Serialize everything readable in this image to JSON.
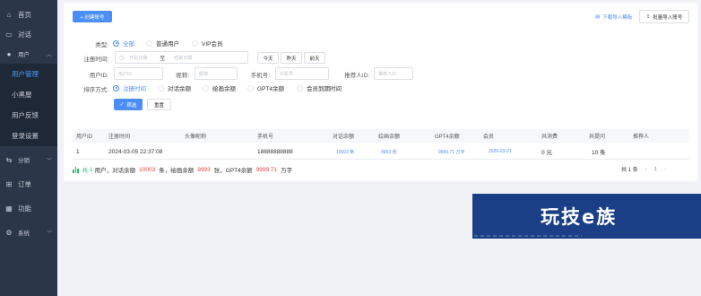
{
  "sidebar": {
    "items": [
      {
        "icon": "home-icon",
        "label": "首页"
      },
      {
        "icon": "chat-icon",
        "label": "对话"
      },
      {
        "icon": "user-icon",
        "label": "用户"
      }
    ],
    "sub_items": [
      {
        "label": "用户管理"
      },
      {
        "label": "小黑屋"
      },
      {
        "label": "用户反馈"
      },
      {
        "label": "登录设置"
      }
    ],
    "more_items": [
      {
        "icon": "share-icon",
        "label": "分销"
      },
      {
        "icon": "cart-icon",
        "label": "订单"
      },
      {
        "icon": "grid-icon",
        "label": "功能"
      },
      {
        "icon": "gear-icon",
        "label": "系统"
      }
    ]
  },
  "toolbar": {
    "create_label": "+ 创建账号",
    "download_label": "下载导入模板",
    "import_label": "批量导入账号"
  },
  "filters": {
    "type_label": "类型:",
    "type_options": [
      "全部",
      "普通用户",
      "VIP会员"
    ],
    "reg_time_label": "注册时间:",
    "start_placeholder": "开始日期",
    "to_label": "至",
    "end_placeholder": "结束日期",
    "quick_dates": [
      "今天",
      "昨天",
      "前天"
    ],
    "userid_label": "用户ID:",
    "userid_placeholder": "用户ID",
    "nickname_label": "昵称:",
    "nickname_placeholder": "昵称",
    "phone_label": "手机号:",
    "phone_placeholder": "手机号",
    "referrer_label": "推荐人ID:",
    "referrer_placeholder": "推荐人ID",
    "sort_label": "排序方式:",
    "sort_options": [
      "注册时间",
      "对话余额",
      "绘画余额",
      "GPT4余额",
      "会员到期时间"
    ],
    "filter_label": "筛选",
    "reset_label": "重置"
  },
  "table": {
    "columns": [
      "用户ID",
      "注册时间",
      "头像昵称",
      "手机号",
      "对话余额",
      "绘画余额",
      "GPT4余额",
      "会员",
      "共消费",
      "共提问",
      "推荐人"
    ],
    "rows": [
      [
        "1",
        "2024-03-05 22:37:08",
        "",
        "18888888888",
        "10003 条",
        "9993 张",
        "9999.71 万字",
        "2026-03-21",
        "0 元",
        "10 条",
        ""
      ]
    ]
  },
  "summary": {
    "prefix": "共",
    "count": "1",
    "text1": "用户，对话余额",
    "chat": "10003",
    "text2": "条，绘画余额",
    "draw": "9993",
    "text3": "张，GPT4余额",
    "gpt4": "9999.71",
    "text4": "万字"
  },
  "pager": {
    "total": "共 1 条",
    "page": "1",
    "prev": "‹",
    "next": "›"
  },
  "banner": {
    "text": "玩技e族"
  },
  "colors": {
    "accent": "#4b8ef7",
    "sidebar": "#2b3648",
    "danger": "#e64545",
    "success": "#19be6b"
  }
}
